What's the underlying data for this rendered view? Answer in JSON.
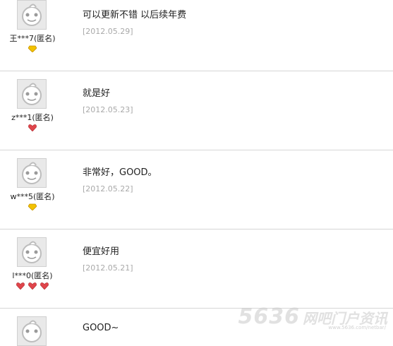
{
  "reviews": [
    {
      "user": "王***7(匿名)",
      "comment": "可以更新不错 以后续年费",
      "date": "[2012.05.29]",
      "badges": [
        "yellow-diamond"
      ]
    },
    {
      "user": "z***1(匿名)",
      "comment": "就是好",
      "date": "[2012.05.23]",
      "badges": [
        "red-heart"
      ]
    },
    {
      "user": "w***5(匿名)",
      "comment": "非常好，GOOD。",
      "date": "[2012.05.22]",
      "badges": [
        "yellow-diamond"
      ]
    },
    {
      "user": "l***0(匿名)",
      "comment": "便宜好用",
      "date": "[2012.05.21]",
      "badges": [
        "red-heart",
        "red-heart",
        "red-heart"
      ]
    },
    {
      "user": "",
      "comment": "GOOD~",
      "date": "",
      "badges": []
    }
  ],
  "watermark": {
    "brand": "5636",
    "site": "网吧门户资讯",
    "url": "www.5636.com/netbar/"
  }
}
